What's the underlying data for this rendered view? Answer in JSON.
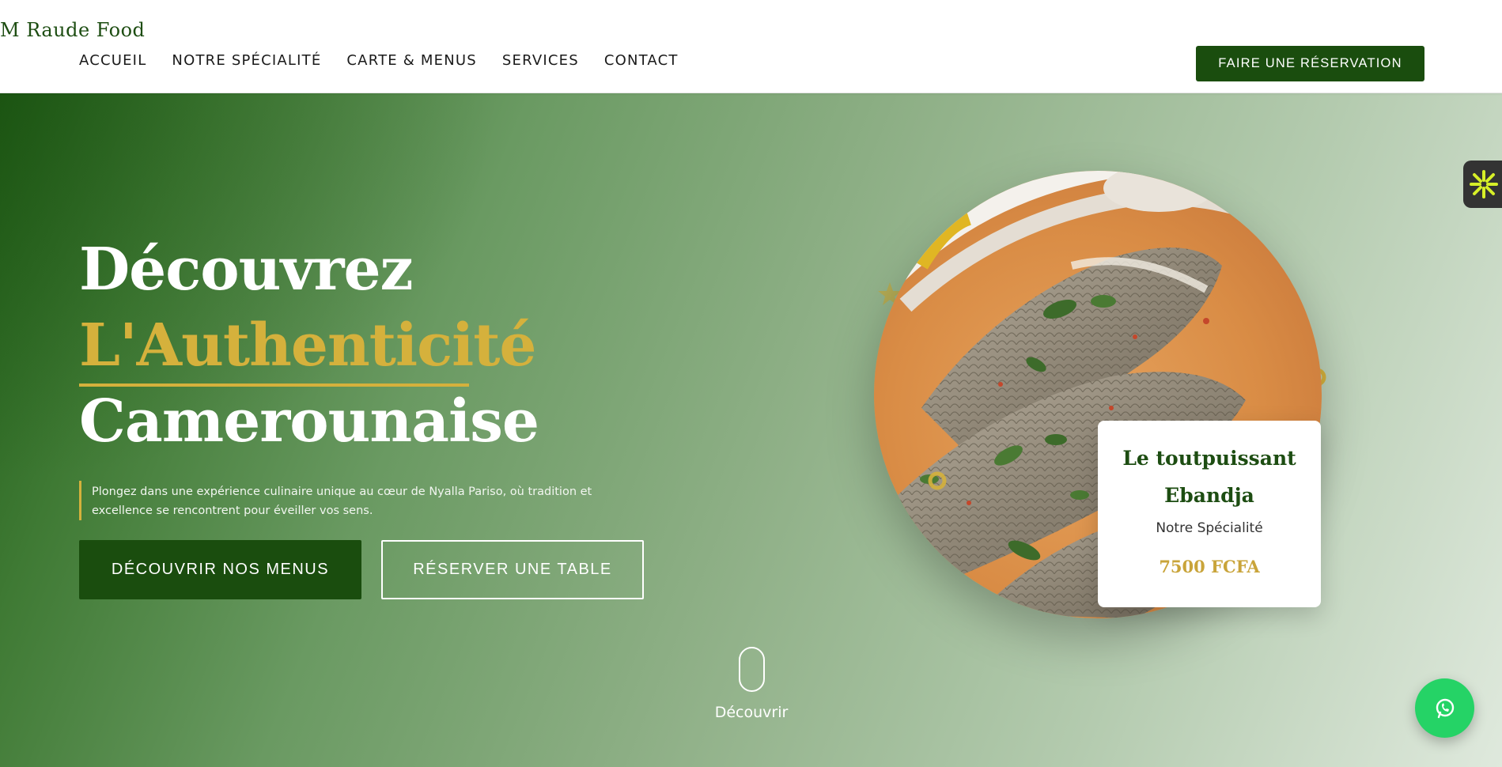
{
  "brand": {
    "name": "M Raude Food"
  },
  "nav": {
    "items": [
      {
        "label": "ACCUEIL"
      },
      {
        "label": "NOTRE SPÉCIALITÉ"
      },
      {
        "label": "CARTE & MENUS"
      },
      {
        "label": "SERVICES"
      },
      {
        "label": "CONTACT"
      }
    ],
    "cta_label": "FAIRE UNE RÉSERVATION"
  },
  "hero": {
    "heading_line1": "Découvrez",
    "heading_line2": "L'Authenticité",
    "heading_line3": "Camerounaise",
    "lead": "Plongez dans une expérience culinaire unique au cœur de Nyalla Pariso, où tradition et excellence se rencontrent pour éveiller vos sens.",
    "primary_button": "DÉCOUVRIR NOS MENUS",
    "secondary_button": "RÉSERVER UNE TABLE",
    "scroll_label": "Découvrir"
  },
  "specialty_card": {
    "title": "Le toutpuissant Ebandja",
    "subtitle": "Notre Spécialité",
    "price": "7500 FCFA"
  },
  "colors": {
    "brand_green": "#1a4d0e",
    "accent_gold": "#d5b13c",
    "whatsapp_green": "#25d366"
  },
  "icons": {
    "side_widget": "accessibility-asterisk-icon",
    "whatsapp": "whatsapp-icon",
    "scroll": "mouse-scroll-icon"
  }
}
